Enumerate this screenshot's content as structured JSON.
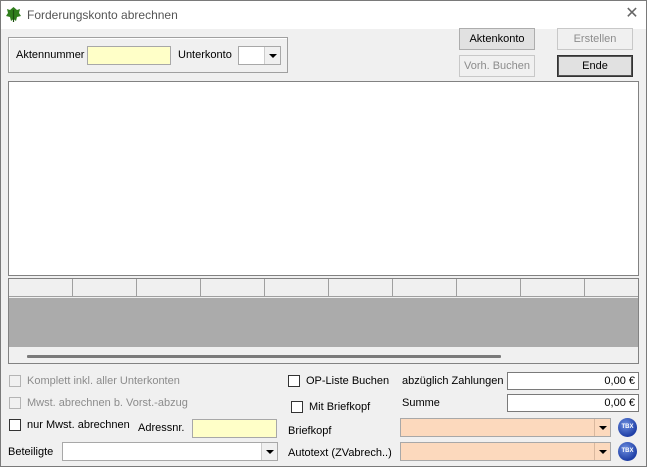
{
  "window": {
    "title": "Forderungskonto abrechnen",
    "close_glyph": "✕"
  },
  "group": {
    "aktennummer_label": "Aktennummer",
    "aktennummer_value": "",
    "unterkonto_label": "Unterkonto",
    "unterkonto_value": ""
  },
  "buttons": {
    "aktenkonto": "Aktenkonto",
    "erstellen": "Erstellen",
    "vorh_buchen": "Vorh. Buchen",
    "ende": "Ende"
  },
  "options": {
    "komplett": "Komplett inkl. aller Unterkonten",
    "mwst_vorst": "Mwst. abrechnen b. Vorst.-abzug",
    "nur_mwst": "nur Mwst. abrechnen",
    "op_liste": "OP-Liste Buchen",
    "mit_briefkopf": "Mit Briefkopf"
  },
  "fields": {
    "adressnr_label": "Adressnr.",
    "adressnr_value": "",
    "beteiligte_label": "Beteiligte",
    "beteiligte_value": "",
    "briefkopf_label": "Briefkopf",
    "briefkopf_value": "",
    "autotext_label": "Autotext (ZVabrech..)",
    "autotext_value": "",
    "abzueglich_label": "abzüglich Zahlungen",
    "abzueglich_value": "0,00 €",
    "summe_label": "Summe",
    "summe_value": "0,00 €",
    "tbx_label": "TBX"
  },
  "colors": {
    "yellow_input": "#ffffc8",
    "peach_combo": "#fcd9bd",
    "grid_body": "#ababab"
  }
}
